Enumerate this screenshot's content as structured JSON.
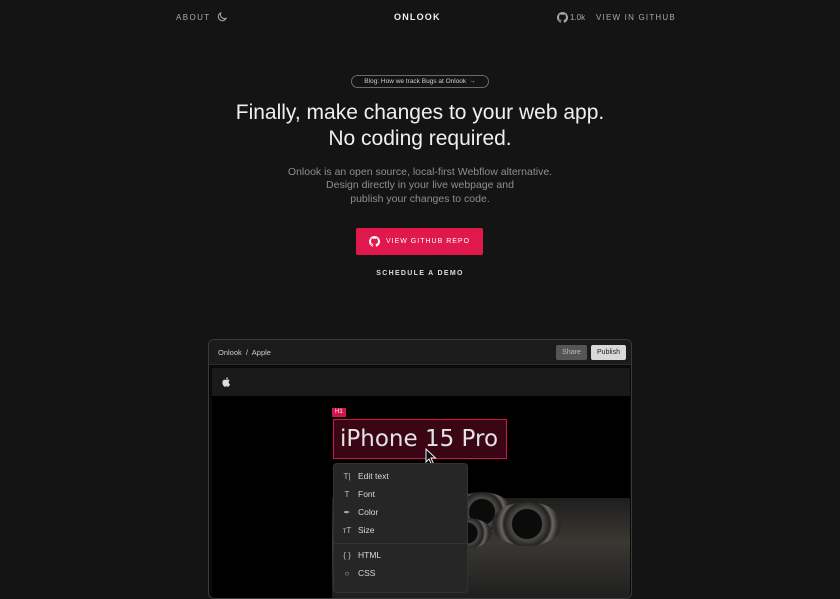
{
  "nav": {
    "about": "ABOUT",
    "logo": "ONLOOK",
    "stars": "1.0k",
    "view_github": "VIEW IN GITHUB"
  },
  "hero": {
    "blog_pill": "Blog: How we track Bugs at Onlook",
    "title_line1": "Finally, make changes to your web app.",
    "title_line2": "No coding required.",
    "sub_line1": "Onlook is an open source, local-first Webflow alternative.",
    "sub_line2": "Design directly in your live webpage and",
    "sub_line3": "publish your changes to code.",
    "cta": "VIEW GITHUB REPO",
    "demo": "SCHEDULE A DEMO"
  },
  "editor": {
    "crumb": "Onlook  /  Apple",
    "share": "Share",
    "publish": "Publish",
    "tag": "H1",
    "h1_text": "iPhone 15 Pro",
    "menu": [
      "Edit text",
      "Font",
      "Color",
      "Size",
      "HTML",
      "CSS"
    ]
  },
  "colors": {
    "accent": "#e0184b",
    "background": "#141414"
  }
}
